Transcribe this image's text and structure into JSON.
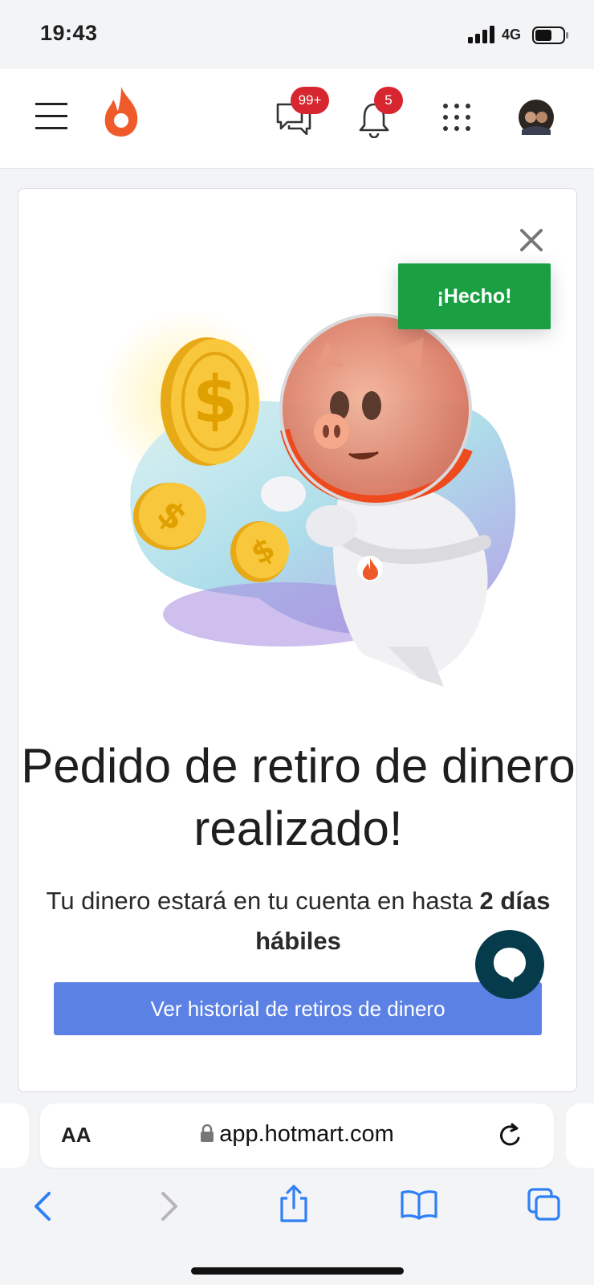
{
  "status_bar": {
    "time": "19:43",
    "network": "4G"
  },
  "header": {
    "messages_badge": "99+",
    "notifications_badge": "5",
    "brand_color": "#ef5a2a"
  },
  "modal": {
    "done_label": "¡Hecho!",
    "title": "Pedido de retiro de dinero realizado!",
    "subtitle_text": "Tu dinero estará en tu cuenta en hasta",
    "subtitle_strong": "2 días hábiles",
    "history_button": "Ver historial de retiros de dinero",
    "button_color": "#5b81e4",
    "done_color": "#1aa043"
  },
  "browser": {
    "text_size_label": "AA",
    "url": "app.hotmart.com"
  }
}
